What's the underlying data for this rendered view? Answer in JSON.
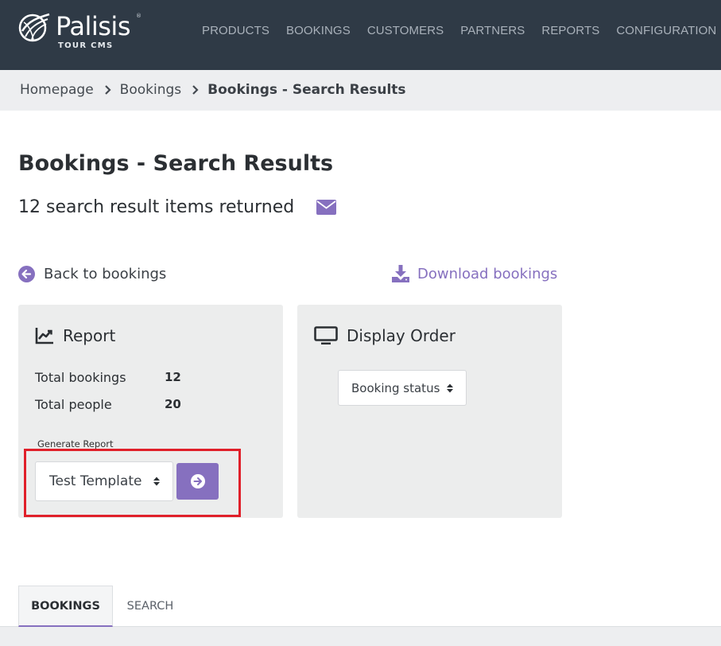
{
  "brand": {
    "name": "Palisis",
    "registered": "®",
    "subtitle": "TOUR CMS"
  },
  "nav": {
    "items": [
      {
        "label": "PRODUCTS"
      },
      {
        "label": "BOOKINGS"
      },
      {
        "label": "CUSTOMERS"
      },
      {
        "label": "PARTNERS"
      },
      {
        "label": "REPORTS"
      },
      {
        "label": "CONFIGURATION"
      }
    ]
  },
  "breadcrumb": {
    "items": [
      {
        "label": "Homepage"
      },
      {
        "label": "Bookings"
      },
      {
        "label": "Bookings - Search Results"
      }
    ]
  },
  "page": {
    "title": "Bookings - Search Results",
    "result_summary": "12 search result items returned"
  },
  "actions": {
    "back_label": "Back to bookings",
    "download_label": "Download bookings"
  },
  "report": {
    "title": "Report",
    "total_bookings_label": "Total bookings",
    "total_bookings_value": "12",
    "total_people_label": "Total people",
    "total_people_value": "20",
    "generate_label": "Generate Report",
    "template_selected": "Test Template"
  },
  "display_order": {
    "title": "Display Order",
    "selected": "Booking status"
  },
  "tabs": [
    {
      "label": "BOOKINGS",
      "active": true
    },
    {
      "label": "SEARCH",
      "active": false
    }
  ],
  "colors": {
    "accent": "#8670bf",
    "topbar": "#2f3a46",
    "highlight": "#e0202a",
    "panel": "#eceded"
  },
  "icons": {
    "logo": "globe-logo-icon",
    "envelope": "envelope-icon",
    "back": "arrow-circle-left-icon",
    "download": "download-icon",
    "report": "line-chart-icon",
    "display": "monitor-icon",
    "go": "arrow-circle-right-icon",
    "select": "sort-updown-icon",
    "chevron": "chevron-right-icon"
  }
}
